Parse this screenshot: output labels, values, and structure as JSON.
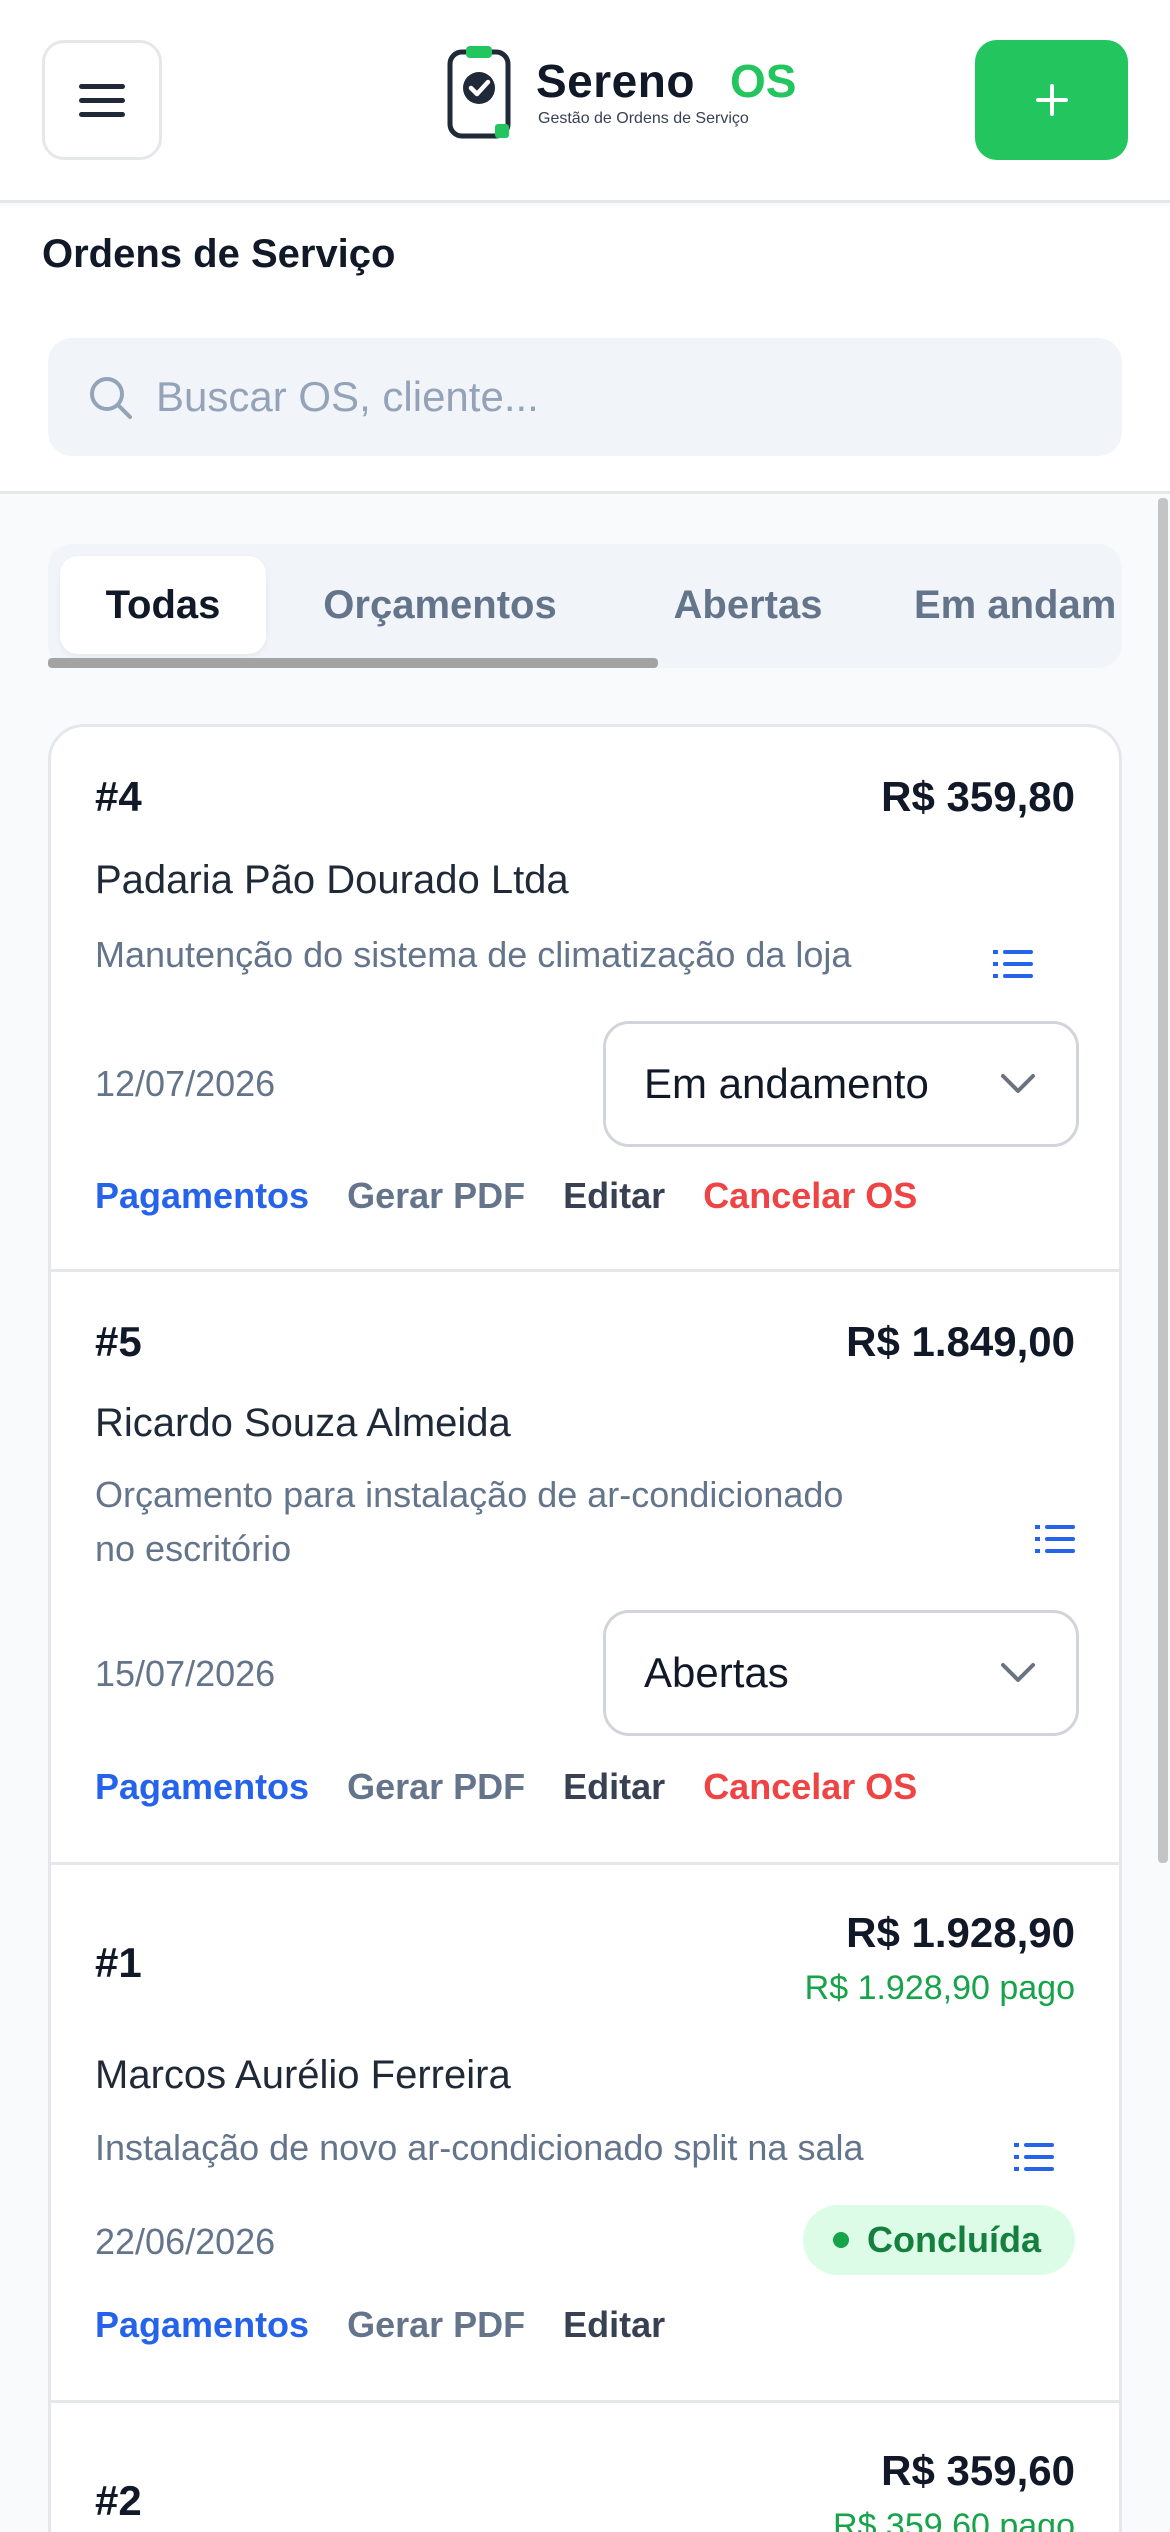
{
  "header": {
    "app_name": "Sereno",
    "app_suffix": "OS",
    "app_subtitle": "Gestão de Ordens de Serviço"
  },
  "page": {
    "title": "Ordens de Serviço"
  },
  "search": {
    "placeholder": "Buscar OS, cliente..."
  },
  "tabs": [
    {
      "label": "Todas",
      "active": true
    },
    {
      "label": "Orçamentos",
      "active": false
    },
    {
      "label": "Abertas",
      "active": false
    },
    {
      "label": "Em andam",
      "active": false
    }
  ],
  "actions": {
    "payments": "Pagamentos",
    "pdf": "Gerar PDF",
    "edit": "Editar",
    "cancel": "Cancelar OS"
  },
  "orders": [
    {
      "number": "#4",
      "amount": "R$ 359,80",
      "client": "Padaria Pão Dourado Ltda",
      "description": "Manutenção do sistema de climatização da loja",
      "date": "12/07/2026",
      "status": "Em andamento"
    },
    {
      "number": "#5",
      "amount": "R$ 1.849,00",
      "client": "Ricardo Souza Almeida",
      "description_line1": "Orçamento para instalação de ar-condicionado",
      "description_line2": "no escritório",
      "date": "15/07/2026",
      "status": "Abertas"
    },
    {
      "number": "#1",
      "amount": "R$ 1.928,90",
      "paid": "R$ 1.928,90 pago",
      "client": "Marcos Aurélio Ferreira",
      "description": "Instalação de novo ar-condicionado split na sala",
      "date": "22/06/2026",
      "status": "Concluída"
    },
    {
      "number": "#2",
      "amount": "R$ 359,60",
      "paid": "R$ 359,60 pago"
    }
  ],
  "colors": {
    "brand_green": "#22c55e",
    "link_blue": "#2563eb",
    "danger_red": "#ef4444",
    "paid_green": "#16a34a"
  }
}
